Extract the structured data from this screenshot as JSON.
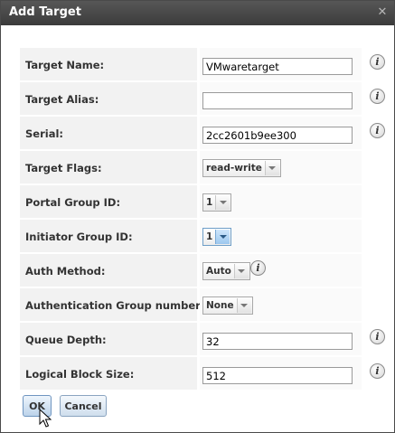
{
  "dialog": {
    "title": "Add Target",
    "close_icon": "close-icon"
  },
  "fields": [
    {
      "label": "Target Name:",
      "type": "text",
      "value": "VMwaretarget",
      "info": true
    },
    {
      "label": "Target Alias:",
      "type": "text",
      "value": "",
      "info": true
    },
    {
      "label": "Serial:",
      "type": "text",
      "value": "2cc2601b9ee300",
      "info": true
    },
    {
      "label": "Target Flags:",
      "type": "select",
      "value": "read-write",
      "info": false
    },
    {
      "label": "Portal Group ID:",
      "type": "select",
      "value": "1",
      "info": false
    },
    {
      "label": "Initiator Group ID:",
      "type": "select",
      "value": "1",
      "info": false,
      "active": true
    },
    {
      "label": "Auth Method:",
      "type": "select",
      "value": "Auto",
      "info": true
    },
    {
      "label": "Authentication Group number:",
      "type": "select",
      "value": "None",
      "info": false
    },
    {
      "label": "Queue Depth:",
      "type": "text",
      "value": "32",
      "info": true
    },
    {
      "label": "Logical Block Size:",
      "type": "text",
      "value": "512",
      "info": true
    }
  ],
  "buttons": {
    "ok": "OK",
    "cancel": "Cancel"
  },
  "info_icon_glyph": "i"
}
